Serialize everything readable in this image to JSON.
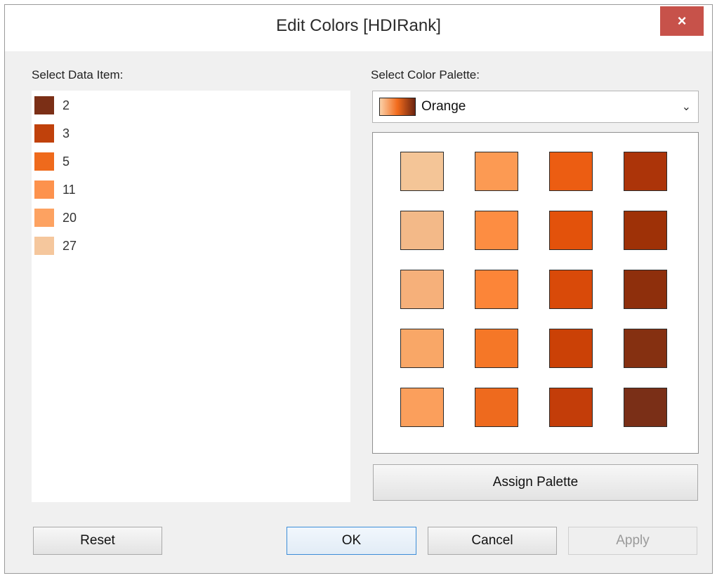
{
  "window": {
    "title": "Edit Colors [HDIRank]",
    "close_icon": "×"
  },
  "left": {
    "label": "Select Data Item:",
    "items": [
      {
        "label": "2",
        "color": "#7b2f16"
      },
      {
        "label": "3",
        "color": "#c0410b"
      },
      {
        "label": "5",
        "color": "#ef6a1c"
      },
      {
        "label": "11",
        "color": "#fd924d"
      },
      {
        "label": "20",
        "color": "#fda261"
      },
      {
        "label": "27",
        "color": "#f5c79d"
      }
    ]
  },
  "right": {
    "label": "Select Color Palette:",
    "palette": {
      "name": "Orange",
      "chevron": "⌄"
    },
    "swatches": [
      [
        "#f4c597",
        "#fc9a53",
        "#ec5d12",
        "#ac3409"
      ],
      [
        "#f3b988",
        "#fd8d42",
        "#e3520b",
        "#9e3107"
      ],
      [
        "#f6b07a",
        "#fc8538",
        "#d94a09",
        "#8e2f0c"
      ],
      [
        "#f9a767",
        "#f57727",
        "#cb4106",
        "#853011"
      ],
      [
        "#fb9f5c",
        "#ee6a1e",
        "#c33d09",
        "#7a2f17"
      ]
    ],
    "assign_label": "Assign Palette"
  },
  "footer": {
    "reset": "Reset",
    "ok": "OK",
    "cancel": "Cancel",
    "apply": "Apply"
  }
}
